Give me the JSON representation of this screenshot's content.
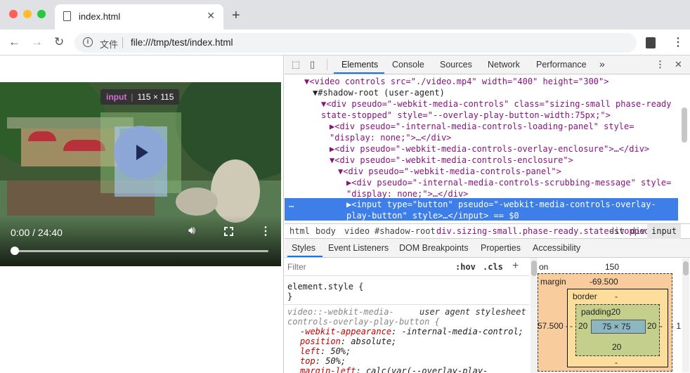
{
  "browser": {
    "tab_title": "index.html",
    "omnibox_label": "文件",
    "url": "file:///tmp/test/index.html"
  },
  "video": {
    "tooltip_tag": "input",
    "tooltip_size": "115 × 115",
    "time": "0:00 / 24:40",
    "progress": 0
  },
  "devtools": {
    "tabs": [
      "Elements",
      "Console",
      "Sources",
      "Network",
      "Performance"
    ],
    "more_tabs": "»",
    "dom_lines": [
      {
        "text": "▼<video controls src=\"./video.mp4\" width=\"400\" height=\"300\">"
      },
      {
        "text": "▼#shadow-root (user-agent)"
      },
      {
        "text": "▼<div pseudo=\"-webkit-media-controls\" class=\"sizing-small phase-ready"
      },
      {
        "text": "state-stopped\" style=\"--overlay-play-button-width:75px;\">"
      },
      {
        "text": "▶<div pseudo=\"-internal-media-controls-loading-panel\" style="
      },
      {
        "text": "\"display: none;\">…</div>"
      },
      {
        "text": "▶<div pseudo=\"-webkit-media-controls-overlay-enclosure\">…</div>"
      },
      {
        "text": "▼<div pseudo=\"-webkit-media-controls-enclosure\">"
      },
      {
        "text": "▼<div pseudo=\"-webkit-media-controls-panel\">"
      },
      {
        "text": "▶<div pseudo=\"-internal-media-controls-scrubbing-message\" style="
      },
      {
        "text": "\"display: none;\">…</div>"
      },
      {
        "text": "▶<input type=\"button\" pseudo=\"-webkit-media-controls-overlay-"
      },
      {
        "text": "play-button\" style>…</input> == $0"
      }
    ],
    "selected_marker": "…",
    "breadcrumbs": [
      "html",
      "body",
      "video",
      "#shadow-root",
      "div.sizing-small.phase-ready.state-stopped",
      "div",
      "div",
      "input"
    ],
    "subtabs": [
      "Styles",
      "Event Listeners",
      "DOM Breakpoints",
      "Properties",
      "Accessibility"
    ],
    "filter_placeholder": "Filter",
    "hov": ":hov",
    "cls": ".cls",
    "add": "+",
    "element_style": "element.style {",
    "close_brace": "}",
    "rule_selector_1": "video::-webkit-media-",
    "rule_selector_2": "controls-overlay-play-button {",
    "rule_source": "user agent stylesheet",
    "declarations": [
      {
        "prop": "-webkit-appearance",
        "value": "-internal-media-control;"
      },
      {
        "prop": "position",
        "value": "absolute;"
      },
      {
        "prop": "left",
        "value": "50%;"
      },
      {
        "prop": "top",
        "value": "50%;"
      },
      {
        "prop": "margin-left",
        "value": "calc(var(--overlay-play-"
      }
    ],
    "boxmodel": {
      "position_label": "on",
      "position_value": "150",
      "margin_label": "margin",
      "margin_value": "-69.500",
      "left_value": "57.500",
      "left_dash": "-",
      "right_value": "- 1",
      "border_label": "border",
      "border_value": "-",
      "padding_label": "padding20",
      "padding_left": "20",
      "padding_right": "20",
      "padding_bottom": "20",
      "content": "75 × 75",
      "border_bottom": "-",
      "left_border": "-",
      "right_border": "-"
    }
  },
  "colors": {
    "accent": "#1a73e8",
    "selection": "#3d7ee8"
  }
}
